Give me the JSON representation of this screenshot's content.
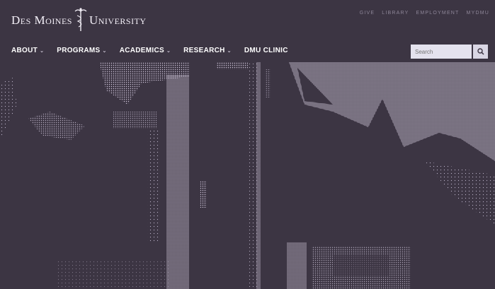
{
  "brand": {
    "name_left": "Des Moines",
    "name_right": "University"
  },
  "utility_nav": [
    "Give",
    "Library",
    "Employment",
    "MyDMU"
  ],
  "main_nav": [
    {
      "label": "ABOUT",
      "has_dropdown": true
    },
    {
      "label": "PROGRAMS",
      "has_dropdown": true
    },
    {
      "label": "ACADEMICS",
      "has_dropdown": true
    },
    {
      "label": "RESEARCH",
      "has_dropdown": true
    },
    {
      "label": "DMU CLINIC",
      "has_dropdown": false
    }
  ],
  "search": {
    "placeholder": "Search"
  },
  "icons": {
    "dropdown": "chevron-down-icon",
    "search": "search-icon",
    "logo": "caduceus-icon"
  },
  "colors": {
    "header_bg": "#3c3543",
    "text": "#ffffff",
    "search_bg": "#e4e2ee"
  }
}
